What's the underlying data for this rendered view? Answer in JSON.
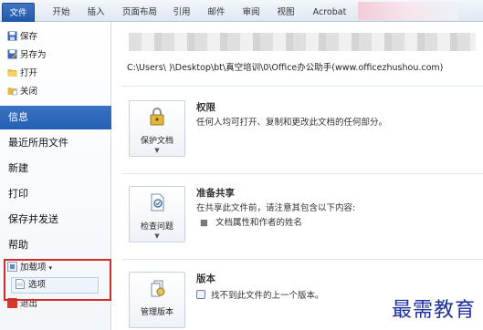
{
  "ribbon": {
    "tabs": [
      "文件",
      "开始",
      "插入",
      "页面布局",
      "引用",
      "邮件",
      "审阅",
      "视图",
      "Acrobat"
    ]
  },
  "leftnav": {
    "small_items": [
      {
        "label": "保存",
        "icon": "save-icon"
      },
      {
        "label": "另存为",
        "icon": "save-as-icon"
      },
      {
        "label": "打开",
        "icon": "open-folder-icon"
      },
      {
        "label": "关闭",
        "icon": "close-folder-icon"
      }
    ],
    "big_items": [
      "信息",
      "最近所用文件",
      "新建",
      "打印",
      "保存并发送",
      "帮助"
    ],
    "active_item": "信息",
    "addins_label": "加载项",
    "options_label": "选项",
    "exit_label": "退出"
  },
  "main": {
    "file_path": "C:\\Users\\        )\\Desktop\\bt\\真空培训\\0\\Office办公助手(www.officezhushou.com)",
    "sections": [
      {
        "button": "保护文档",
        "button_icon": "lock-key-icon",
        "title": "权限",
        "desc": "任何人均可打开、复制和更改此文档的任何部分。",
        "bullet": ""
      },
      {
        "button": "检查问题",
        "button_icon": "check-document-icon",
        "title": "准备共享",
        "desc": "在共享此文件前，请注意其包含以下内容:",
        "bullet": "文档属性和作者的姓名"
      },
      {
        "button": "管理版本",
        "button_icon": "versions-icon",
        "title": "版本",
        "desc": "找不到此文件的上一个版本。",
        "bullet": ""
      }
    ]
  },
  "watermark": "最需教育",
  "colors": {
    "accent": "#2460b3",
    "highlight": "#d22b2b",
    "watermark": "#1d2f9a"
  }
}
